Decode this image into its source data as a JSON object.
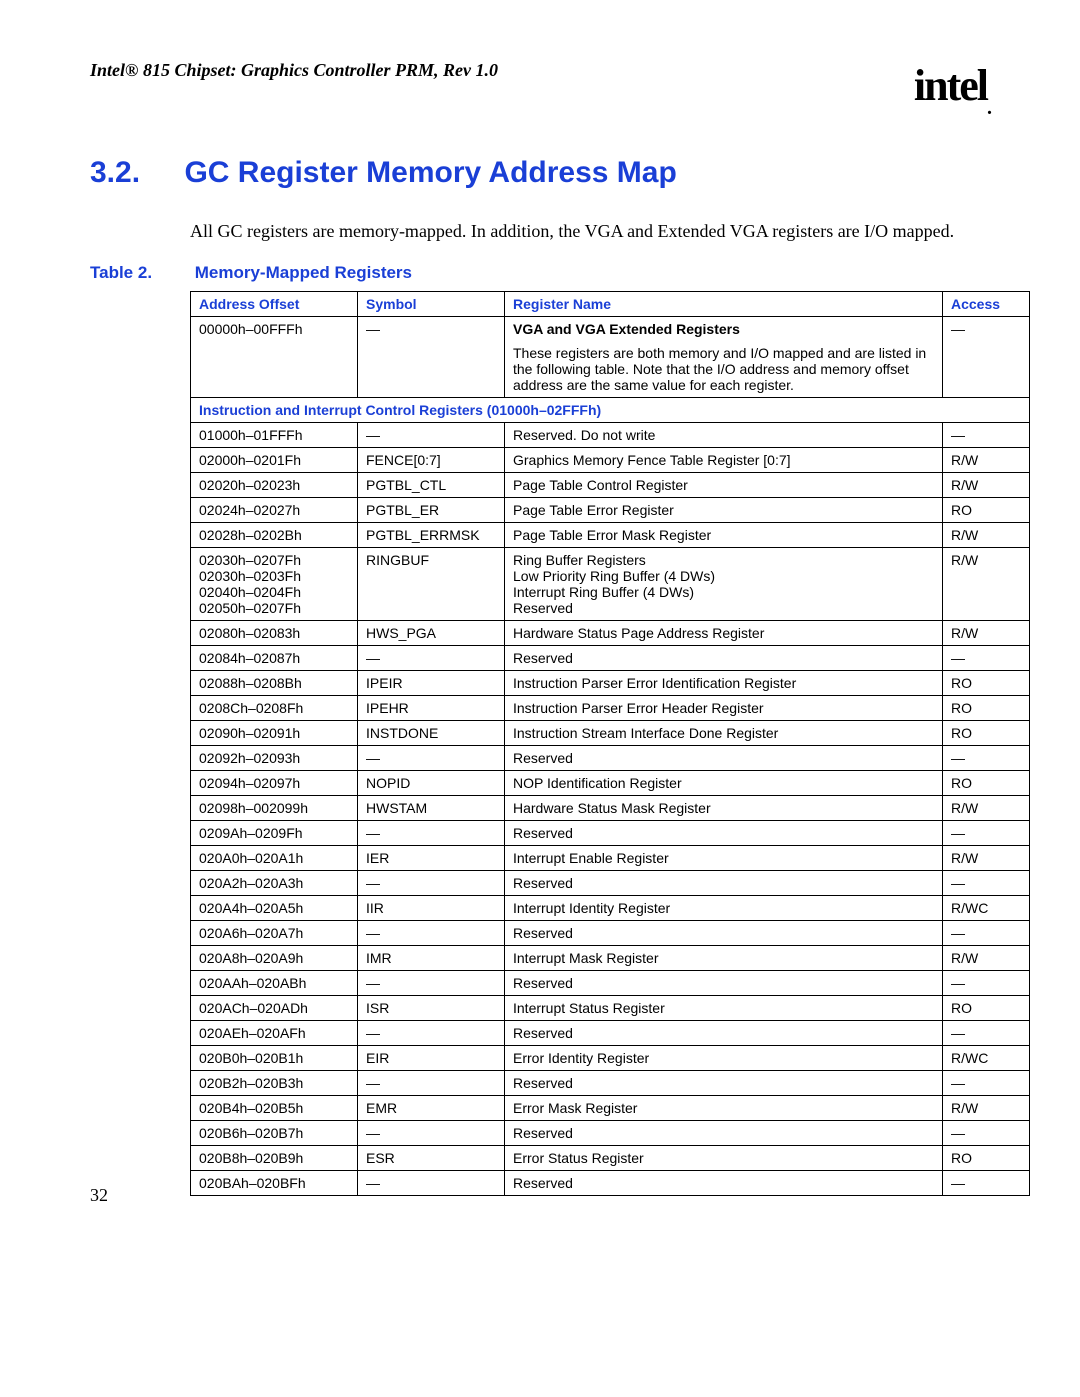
{
  "doc_header": "Intel® 815 Chipset: Graphics Controller PRM, Rev 1.0",
  "logo_text": "intel",
  "section": {
    "number": "3.2.",
    "title": "GC Register Memory Address Map"
  },
  "body_paragraph": "All GC registers are memory-mapped. In addition, the VGA and Extended VGA registers are I/O mapped.",
  "table": {
    "caption_label": "Table 2.",
    "caption_title": "Memory-Mapped Registers",
    "headers": {
      "address": "Address Offset",
      "symbol": "Symbol",
      "name": "Register Name",
      "access": "Access"
    },
    "first_row": {
      "address": "00000h–00FFFh",
      "symbol": "—",
      "name_title": "VGA and VGA Extended Registers",
      "name_body": "These registers are both memory and I/O mapped and are listed in the following table. Note that the I/O address and memory offset address are the same value for each register.",
      "access": "—"
    },
    "section_header": "Instruction and Interrupt Control Registers (01000h–02FFFh)",
    "rows": [
      {
        "address": "01000h–01FFFh",
        "symbol": "—",
        "name": "Reserved. Do not write",
        "access": "—"
      },
      {
        "address": "02000h–0201Fh",
        "symbol": "FENCE[0:7]",
        "name": "Graphics Memory Fence Table Register [0:7]",
        "access": "R/W"
      },
      {
        "address": "02020h–02023h",
        "symbol": "PGTBL_CTL",
        "name": "Page Table Control Register",
        "access": "R/W"
      },
      {
        "address": "02024h–02027h",
        "symbol": "PGTBL_ER",
        "name": "Page Table Error Register",
        "access": "RO"
      },
      {
        "address": "02028h–0202Bh",
        "symbol": "PGTBL_ERRMSK",
        "name": "Page Table Error Mask Register",
        "access": "R/W"
      },
      {
        "address": "02030h–0207Fh\n02030h–0203Fh\n02040h–0204Fh\n02050h–0207Fh",
        "symbol": "RINGBUF",
        "name": "Ring Buffer Registers\nLow Priority Ring Buffer (4 DWs)\nInterrupt Ring Buffer (4 DWs)\nReserved",
        "access": "R/W"
      },
      {
        "address": "02080h–02083h",
        "symbol": "HWS_PGA",
        "name": "Hardware Status Page Address Register",
        "access": "R/W"
      },
      {
        "address": "02084h–02087h",
        "symbol": "—",
        "name": "Reserved",
        "access": "—"
      },
      {
        "address": "02088h–0208Bh",
        "symbol": "IPEIR",
        "name": "Instruction Parser Error Identification Register",
        "access": "RO"
      },
      {
        "address": "0208Ch–0208Fh",
        "symbol": "IPEHR",
        "name": "Instruction Parser Error Header Register",
        "access": "RO"
      },
      {
        "address": "02090h–02091h",
        "symbol": "INSTDONE",
        "name": "Instruction Stream Interface Done Register",
        "access": "RO"
      },
      {
        "address": "02092h–02093h",
        "symbol": "—",
        "name": "Reserved",
        "access": "—"
      },
      {
        "address": "02094h–02097h",
        "symbol": "NOPID",
        "name": "NOP Identification Register",
        "access": "RO"
      },
      {
        "address": "02098h–002099h",
        "symbol": "HWSTAM",
        "name": "Hardware Status Mask Register",
        "access": "R/W"
      },
      {
        "address": "0209Ah–0209Fh",
        "symbol": "—",
        "name": "Reserved",
        "access": "—"
      },
      {
        "address": "020A0h–020A1h",
        "symbol": "IER",
        "name": "Interrupt Enable Register",
        "access": "R/W"
      },
      {
        "address": "020A2h–020A3h",
        "symbol": "—",
        "name": "Reserved",
        "access": "—"
      },
      {
        "address": "020A4h–020A5h",
        "symbol": "IIR",
        "name": "Interrupt Identity Register",
        "access": "R/WC"
      },
      {
        "address": "020A6h–020A7h",
        "symbol": "—",
        "name": "Reserved",
        "access": "—"
      },
      {
        "address": "020A8h–020A9h",
        "symbol": "IMR",
        "name": "Interrupt Mask Register",
        "access": "R/W"
      },
      {
        "address": "020AAh–020ABh",
        "symbol": "—",
        "name": "Reserved",
        "access": "—"
      },
      {
        "address": "020ACh–020ADh",
        "symbol": "ISR",
        "name": "Interrupt Status Register",
        "access": "RO"
      },
      {
        "address": "020AEh–020AFh",
        "symbol": "—",
        "name": "Reserved",
        "access": "—"
      },
      {
        "address": "020B0h–020B1h",
        "symbol": "EIR",
        "name": "Error Identity Register",
        "access": "R/WC"
      },
      {
        "address": "020B2h–020B3h",
        "symbol": "—",
        "name": "Reserved",
        "access": "—"
      },
      {
        "address": "020B4h–020B5h",
        "symbol": "EMR",
        "name": "Error Mask Register",
        "access": "R/W"
      },
      {
        "address": "020B6h–020B7h",
        "symbol": "—",
        "name": "Reserved",
        "access": "—"
      },
      {
        "address": "020B8h–020B9h",
        "symbol": "ESR",
        "name": "Error Status Register",
        "access": "RO"
      },
      {
        "address": "020BAh–020BFh",
        "symbol": "—",
        "name": "Reserved",
        "access": "—"
      }
    ]
  },
  "page_number": "32"
}
